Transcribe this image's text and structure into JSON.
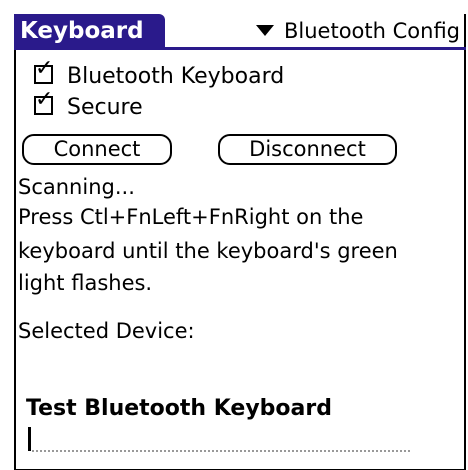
{
  "header": {
    "title": "Keyboard",
    "category": "Bluetooth Config"
  },
  "options": {
    "bluetooth_keyboard": {
      "label": "Bluetooth Keyboard",
      "checked": true
    },
    "secure": {
      "label": "Secure",
      "checked": true
    }
  },
  "buttons": {
    "connect": "Connect",
    "disconnect": "Disconnect"
  },
  "status": {
    "scanning": "Scanning...",
    "instructions": [
      "Press Ctl+FnLeft+FnRight on the",
      "keyboard until the keyboard's green",
      "light flashes."
    ],
    "selected_device_label": "Selected Device:",
    "selected_device_value": ""
  },
  "test": {
    "label": "Test Bluetooth Keyboard",
    "value": ""
  },
  "colors": {
    "title_bar": "#2a1a8b"
  }
}
